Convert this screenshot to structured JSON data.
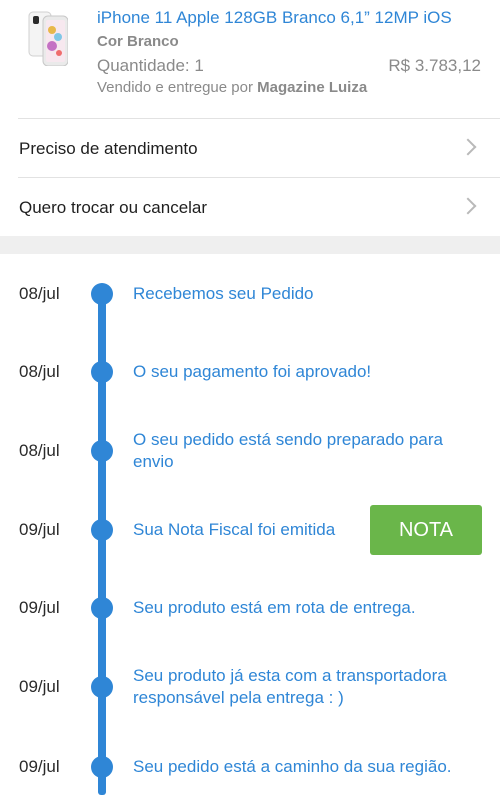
{
  "product": {
    "title": "iPhone 11 Apple 128GB Branco 6,1” 12MP iOS",
    "color": "Cor Branco",
    "quantity": "Quantidade: 1",
    "price": "R$ 3.783,12",
    "seller_prefix": "Vendido e entregue por",
    "seller_name": "Magazine Luiza",
    "image_icon": "iphone-product-thumbnail"
  },
  "menu": {
    "items": [
      {
        "label": "Preciso de atendimento",
        "icon": "chevron-right-icon"
      },
      {
        "label": "Quero trocar ou cancelar",
        "icon": "chevron-right-icon"
      }
    ]
  },
  "timeline": {
    "accent_color": "#2f86d6",
    "events": [
      {
        "date": "08/jul",
        "text": "Recebemos seu Pedido"
      },
      {
        "date": "08/jul",
        "text": "O seu pagamento foi aprovado!"
      },
      {
        "date": "08/jul",
        "text": "O seu pedido está sendo preparado para envio"
      },
      {
        "date": "09/jul",
        "text": "Sua Nota Fiscal foi emitida"
      },
      {
        "date": "09/jul",
        "text": "Seu produto está em rota de entrega."
      },
      {
        "date": "09/jul",
        "text": "Seu produto já esta com a transportadora responsável pela entrega : )"
      },
      {
        "date": "09/jul",
        "text": "Seu pedido está a caminho da sua região."
      }
    ],
    "nota_button_label": "NOTA",
    "nota_button_color": "#6ab64a"
  }
}
